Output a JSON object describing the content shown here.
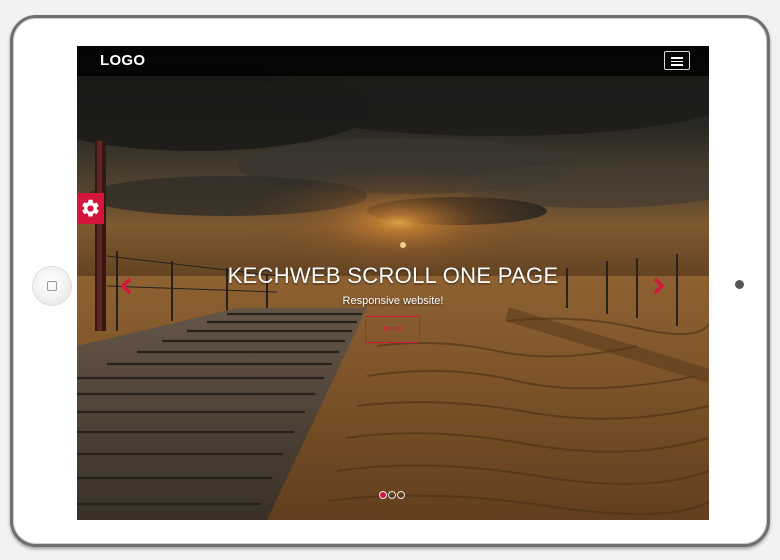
{
  "navbar": {
    "logo": "LOGO",
    "menu_icon": "hamburger-menu-icon"
  },
  "settings": {
    "icon": "gear-icon",
    "accent_color": "#d4163b"
  },
  "hero": {
    "title": "KECHWEB SCROLL ONE PAGE",
    "subtitle": "Responsive website!",
    "button_label": "more"
  },
  "slider": {
    "prev_icon": "chevron-left-icon",
    "next_icon": "chevron-right-icon",
    "slide_count": 3,
    "active_slide": 1
  },
  "colors": {
    "accent": "#d4163b",
    "navbar": "#000000"
  }
}
